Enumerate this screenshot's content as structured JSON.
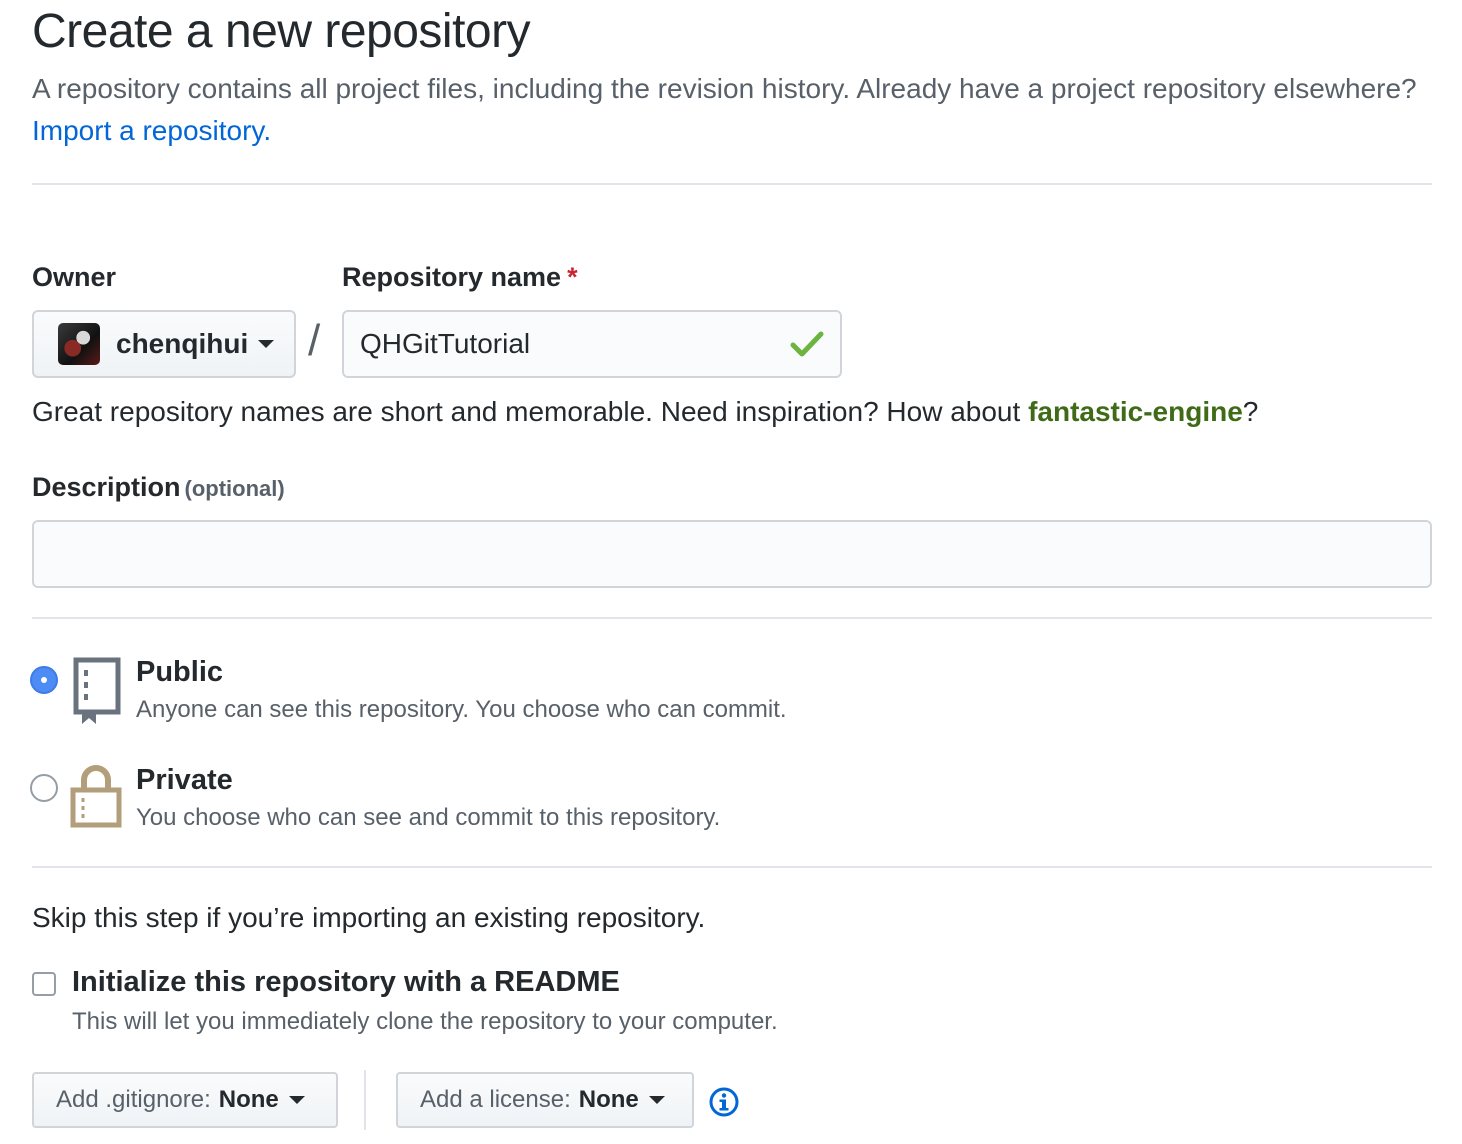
{
  "header": {
    "title": "Create a new repository",
    "intro_text": "A repository contains all project files, including the revision history. Already have a project repository elsewhere?",
    "import_link": "Import a repository."
  },
  "owner": {
    "label": "Owner",
    "selected": "chenqihui"
  },
  "repo_name": {
    "label": "Repository name",
    "required_mark": "*",
    "slash": "/",
    "value": "QHGitTutorial",
    "valid_icon": "check-icon"
  },
  "name_help": {
    "prefix": "Great repository names are short and memorable. Need inspiration? How about ",
    "suggestion": "fantastic-engine",
    "suffix": "?"
  },
  "description": {
    "label": "Description",
    "optional": "(optional)",
    "value": ""
  },
  "visibility": {
    "options": [
      {
        "title": "Public",
        "desc": "Anyone can see this repository. You choose who can commit.",
        "checked": true,
        "icon": "repo-book-icon"
      },
      {
        "title": "Private",
        "desc": "You choose who can see and commit to this repository.",
        "checked": false,
        "icon": "lock-icon"
      }
    ]
  },
  "init": {
    "skip_note": "Skip this step if you’re importing an existing repository.",
    "readme_label": "Initialize this repository with a README",
    "readme_note": "This will let you immediately clone the repository to your computer.",
    "readme_checked": false
  },
  "extras": {
    "gitignore_label": "Add .gitignore:",
    "gitignore_value": "None",
    "license_label": "Add a license:",
    "license_value": "None",
    "info_icon": "info-icon"
  },
  "colors": {
    "link": "#0366d6",
    "suggestion": "#3f6b17",
    "required": "#cb2431",
    "radio_checked": "#4d8cf5",
    "check": "#6cb33f"
  }
}
